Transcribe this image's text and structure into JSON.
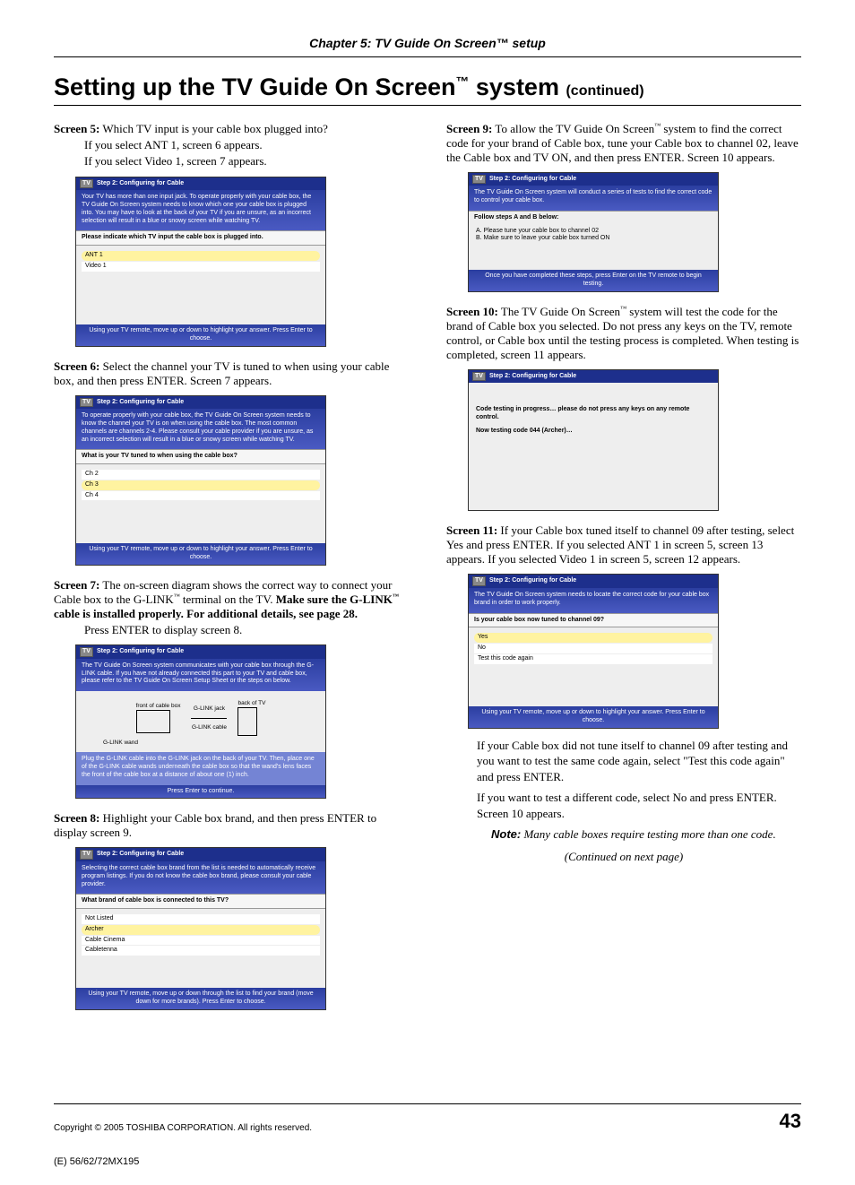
{
  "chapter": "Chapter 5: TV Guide On Screen™ setup",
  "title_main": "Setting up the TV Guide On Screen",
  "title_tm": "™",
  "title_suffix": " system ",
  "title_cont": "(continued)",
  "s5": {
    "label": "Screen 5:",
    "first": "Which TV input is your cable box plugged into?",
    "line2": "If you select ANT 1, screen 6 appears.",
    "line3": "If you select Video 1, screen 7 appears."
  },
  "shot5": {
    "bar": "Step 2: Configuring for Cable",
    "desc": "Your TV has more than one input jack. To operate properly with your cable box, the TV Guide On Screen system needs to know which one your cable box is plugged into. You may have to look at the back of your TV if you are unsure, as an incorrect selection will result in a blue or snowy screen while watching TV.",
    "mid": "Please indicate which TV input the cable box is plugged into.",
    "opt1": "ANT 1",
    "opt2": "Video 1",
    "foot": "Using your TV remote, move up or down to highlight your answer. Press Enter to choose."
  },
  "s6": {
    "label": "Screen 6:",
    "first": "Select the channel your TV is tuned to when using your cable box, and then press ENTER. Screen 7 appears."
  },
  "shot6": {
    "bar": "Step 2: Configuring for Cable",
    "desc": "To operate properly with your cable box, the TV Guide On Screen system needs to know the channel your TV is on when using the cable box. The most common channels are channels 2-4. Please consult your cable provider if you are unsure, as an incorrect selection will result in a blue or snowy screen while watching TV.",
    "mid": "What is your TV tuned to when using the cable box?",
    "opt1": "Ch 2",
    "opt2": "Ch 3",
    "opt3": "Ch 4",
    "foot": "Using your TV remote, move up or down to highlight your answer. Press Enter to choose."
  },
  "s7": {
    "label": "Screen 7:",
    "first": "The on-screen diagram shows the correct way to connect your Cable box to the G-LINK",
    "first_tail": " terminal on the TV. ",
    "bold1": "Make sure the G-LINK",
    "bold1_tail": " cable is installed properly. For additional details, see page 28.",
    "line4": "Press ENTER to display screen 8."
  },
  "shot7": {
    "bar": "Step 2: Configuring for Cable",
    "desc": "The TV Guide On Screen system communicates with your cable box through the G-LINK cable. If you have not already connected this part to your TV and cable box, please refer to the TV Guide On Screen Setup Sheet or the steps on below.",
    "lbl_front": "front of cable box",
    "lbl_glink": "G-LINK jack",
    "lbl_back": "back of TV",
    "lbl_cable": "G-LINK cable",
    "lbl_wand": "G-LINK wand",
    "desc2": "Plug the G-LINK cable into the G-LINK jack on the back of your TV. Then, place one of the G-LINK cable wands underneath the cable box so that the wand's lens faces the front of the cable box at a distance of about one (1) inch.",
    "foot": "Press Enter to continue."
  },
  "s8": {
    "label": "Screen 8:",
    "first": "Highlight your Cable box brand, and then press ENTER to display screen 9."
  },
  "shot8": {
    "bar": "Step 2: Configuring for Cable",
    "desc": "Selecting the correct cable box brand from the list is needed to automatically receive program listings. If you do not know the cable box brand, please consult your cable provider.",
    "mid": "What brand of cable box is connected to this TV?",
    "opt1": "Not Listed",
    "opt2": "Archer",
    "opt3": "Cable Cinema",
    "opt4": "Cabletenna",
    "foot": "Using your TV remote, move up or down through the list to find your brand (move down for more brands). Press Enter to choose."
  },
  "s9": {
    "label": "Screen 9:",
    "first": "To allow the TV Guide On Screen",
    "first_tail": " system to find the correct code for your brand of Cable box, tune your Cable box to channel 02, leave the Cable box and TV ON, and then press ENTER. Screen 10 appears."
  },
  "shot9": {
    "bar": "Step 2: Configuring for Cable",
    "desc": "The TV Guide On Screen system will conduct a series of tests to find the correct code to control your cable box.",
    "mid": "Follow steps A and B below:",
    "stepA": "A.  Please tune your cable box to channel 02",
    "stepB": "B.  Make sure to leave your cable box turned ON",
    "foot": "Once you have completed these steps, press Enter on the TV remote to begin testing."
  },
  "s10": {
    "label": "Screen 10:",
    "first": "The TV Guide On Screen",
    "first_tail": " system will test the code for the brand of Cable box you selected. Do not press any keys on the TV, remote control, or Cable box until the testing process is completed. When testing is completed, screen 11 appears."
  },
  "shot10": {
    "bar": "Step 2: Configuring for Cable",
    "line1": "Code testing in progress… please do not press any keys on any remote control.",
    "line2": "Now testing code 044 (Archer)…"
  },
  "s11": {
    "label": "Screen 11:",
    "first": "If your Cable box tuned itself to channel 09 after testing, select Yes and press ENTER. If you selected ANT 1 in screen 5, screen 13 appears. If you selected Video 1 in screen 5, screen 12 appears."
  },
  "shot11": {
    "bar": "Step 2: Configuring for Cable",
    "desc": "The TV Guide On Screen system needs to locate the correct code for your cable box brand in order to work properly.",
    "mid": "Is your cable box now tuned to channel 09?",
    "opt1": "Yes",
    "opt2": "No",
    "opt3": "Test this code again",
    "foot": "Using your TV remote, move up or down to highlight your answer. Press Enter to choose."
  },
  "post11": {
    "p1": "If your Cable box did not tune itself to channel 09 after testing and you want to test the same code again, select \"Test this code again\" and press ENTER.",
    "p2": "If you want to test a different code, select No and press ENTER. Screen 10 appears.",
    "note_label": "Note:",
    "note": " Many cable boxes require testing more than one code.",
    "cont": "(Continued on next page)"
  },
  "footer": {
    "copyright": "Copyright © 2005 TOSHIBA CORPORATION. All rights reserved.",
    "page": "43",
    "model": "(E) 56/62/72MX195"
  },
  "tvicon": "TV"
}
